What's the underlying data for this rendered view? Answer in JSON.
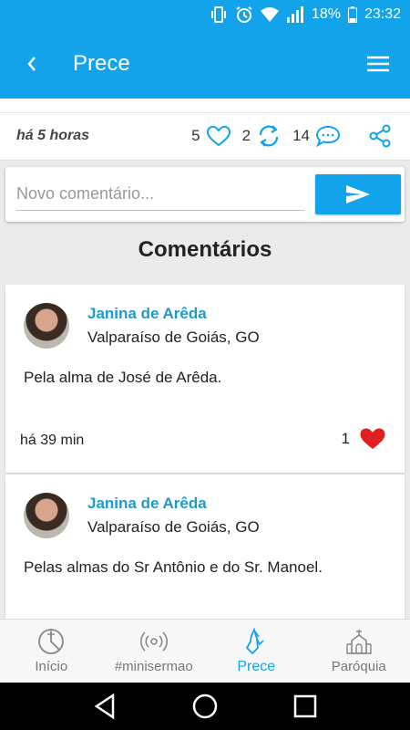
{
  "status_bar": {
    "battery": "18%",
    "time": "23:32"
  },
  "app_bar": {
    "title": "Prece"
  },
  "post": {
    "time": "há 5 horas",
    "likes": "5",
    "shares": "2",
    "comments": "14"
  },
  "comment_form": {
    "placeholder": "Novo comentário..."
  },
  "comments_title": "Comentários",
  "comments": [
    {
      "author": "Janina de Arêda",
      "location": "Valparaíso de Goiás, GO",
      "text": "Pela alma de José de Arêda.",
      "time": "há 39 min",
      "likes": "1"
    },
    {
      "author": "Janina de Arêda",
      "location": "Valparaíso de Goiás, GO",
      "text": "Pelas almas do Sr Antônio e do Sr. Manoel."
    }
  ],
  "bottom_nav": [
    {
      "label": "Início",
      "icon": "home-icon"
    },
    {
      "label": "#minisermao",
      "icon": "broadcast-icon"
    },
    {
      "label": "Prece",
      "icon": "praying-hands-icon",
      "active": true
    },
    {
      "label": "Paróquia",
      "icon": "church-icon"
    }
  ],
  "colors": {
    "primary": "#12a3ea",
    "like": "#e02020",
    "author": "#1f9bc9"
  }
}
